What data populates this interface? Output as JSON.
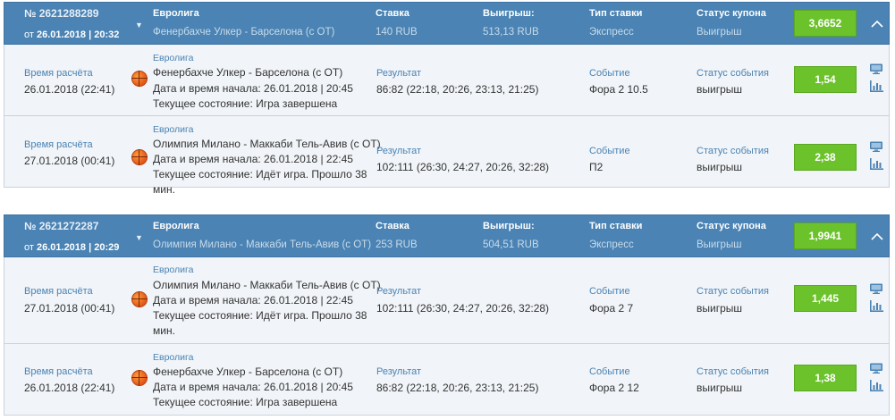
{
  "labels": {
    "stake": "Ставка",
    "win": "Выигрыш:",
    "bet_type": "Тип ставки",
    "coupon_status": "Статус купона",
    "calc_time": "Время расчёта",
    "result": "Результат",
    "event": "Событие",
    "event_status": "Статус события"
  },
  "coupons": [
    {
      "number": "№ 2621288289",
      "date_prefix": "от",
      "date": "26.01.2018 | 20:32",
      "league": "Евролига",
      "match": "Фенербахче Улкер - Барселона (с ОТ)",
      "stake": "140 RUB",
      "win": "513,13 RUB",
      "bet_type": "Экспресс",
      "status": "Выигрыш",
      "total_odds": "3,6652",
      "events": [
        {
          "calc_time": "26.01.2018 (22:41)",
          "league": "Евролига",
          "line1": "Фенербахче Улкер - Барселона (с ОТ)",
          "line2": "Дата и время начала: 26.01.2018 | 20:45",
          "line3": "Текущее состояние: Игра завершена",
          "line4": "",
          "result": "86:82 (22:18, 20:26, 23:13, 21:25)",
          "event": "Фора 2 10.5",
          "status": "выигрыш",
          "odds": "1,54"
        },
        {
          "calc_time": "27.01.2018 (00:41)",
          "league": "Евролига",
          "line1": "Олимпия Милано - Маккаби Тель-Авив (с ОТ)",
          "line2": "Дата и время начала: 26.01.2018 | 22:45",
          "line3": "Текущее состояние: Идёт игра. Прошло 38",
          "line4": "мин.",
          "result": "102:111 (26:30, 24:27, 20:26, 32:28)",
          "event": "П2",
          "status": "выигрыш",
          "odds": "2,38"
        }
      ]
    },
    {
      "number": "№ 2621272287",
      "date_prefix": "от",
      "date": "26.01.2018 | 20:29",
      "league": "Евролига",
      "match": "Олимпия Милано - Маккаби Тель-Авив (с ОТ)",
      "stake": "253 RUB",
      "win": "504,51 RUB",
      "bet_type": "Экспресс",
      "status": "Выигрыш",
      "total_odds": "1,9941",
      "events": [
        {
          "calc_time": "27.01.2018 (00:41)",
          "league": "Евролига",
          "line1": "Олимпия Милано - Маккаби Тель-Авив (с ОТ)",
          "line2": "Дата и время начала: 26.01.2018 | 22:45",
          "line3": "Текущее состояние: Идёт игра. Прошло 38",
          "line4": "мин.",
          "result": "102:111 (26:30, 24:27, 20:26, 32:28)",
          "event": "Фора 2 7",
          "status": "выигрыш",
          "odds": "1,445"
        },
        {
          "calc_time": "26.01.2018 (22:41)",
          "league": "Евролига",
          "line1": "Фенербахче Улкер - Барселона (с ОТ)",
          "line2": "Дата и время начала: 26.01.2018 | 20:45",
          "line3": "Текущее состояние: Игра завершена",
          "line4": "",
          "result": "86:82 (22:18, 20:26, 23:13, 21:25)",
          "event": "Фора 2 12",
          "status": "выигрыш",
          "odds": "1,38"
        }
      ]
    }
  ]
}
